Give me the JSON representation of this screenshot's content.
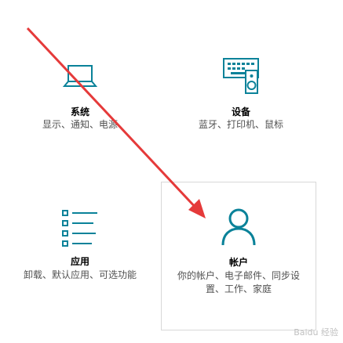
{
  "tiles": {
    "system": {
      "title": "系统",
      "desc": "显示、通知、电源",
      "icon": "laptop-icon"
    },
    "devices": {
      "title": "设备",
      "desc": "蓝牙、打印机、鼠标",
      "icon": "keyboard-speaker-icon"
    },
    "apps": {
      "title": "应用",
      "desc": "卸载、默认应用、可选功能",
      "icon": "list-icon"
    },
    "accounts": {
      "title": "帐户",
      "desc": "你的帐户、电子邮件、同步设置、工作、家庭",
      "icon": "person-icon"
    }
  },
  "colors": {
    "accent": "#0a8299",
    "annotation_arrow": "#e53a3a"
  },
  "watermark": "Baidu 经验"
}
